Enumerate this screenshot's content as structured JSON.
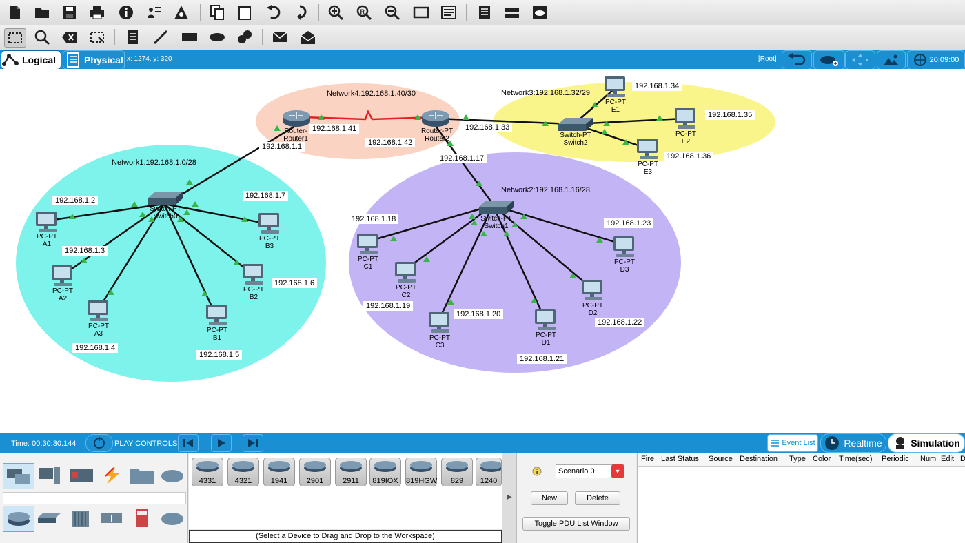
{
  "toolbar1": {
    "icons": [
      "new-file-icon",
      "open-folder-icon",
      "save-icon",
      "print-icon",
      "info-icon",
      "activity-wizard-icon",
      "network-info-icon",
      "copy-icon",
      "paste-icon",
      "undo-icon",
      "redo-icon",
      "zoom-in-icon",
      "zoom-reset-icon",
      "zoom-out-icon",
      "drawing-palette-icon",
      "custom-device-icon",
      "notes-icon",
      "device-dialog-icon",
      "cloud-viewer-icon"
    ]
  },
  "toolbar2": {
    "icons": [
      "select-icon",
      "inspect-icon",
      "delete-icon",
      "resize-icon",
      "note-icon",
      "line-icon",
      "rectangle-icon",
      "ellipse-icon",
      "freeform-icon",
      "add-simple-pdu-icon",
      "add-complex-pdu-icon"
    ]
  },
  "tabs": {
    "logical": "Logical",
    "physical": "Physical",
    "coords": "x: 1274, y: 320",
    "root": "[Root]",
    "clock": "20:09:00"
  },
  "networks": {
    "n1": "Network1:192.168.1.0/28",
    "n2": "Network2:192.168.1.16/28",
    "n3": "Network3:192.168.1.32/29",
    "n4": "Network4:192.168.1.40/30"
  },
  "ips": {
    "r1_s": "192.168.1.41",
    "r1_f": "192.168.1.1",
    "r2_s": "192.168.1.42",
    "r2_f0": "192.168.1.33",
    "r2_f1": "192.168.1.17",
    "a1": "192.168.1.2",
    "a2": "192.168.1.3",
    "a3": "192.168.1.4",
    "b1": "192.168.1.5",
    "b2": "192.168.1.6",
    "b3": "192.168.1.7",
    "c1": "192.168.1.18",
    "c2": "192.168.1.19",
    "c3": "192.168.1.20",
    "d1": "192.168.1.21",
    "d2": "192.168.1.22",
    "d3": "192.168.1.23",
    "e1": "192.168.1.34",
    "e2": "192.168.1.35",
    "e3": "192.168.1.36"
  },
  "devices": {
    "router1": {
      "type": "Router-",
      "name": "Router1"
    },
    "router2": {
      "type": "Router-PT",
      "name": "Router2"
    },
    "switch0": {
      "type": "Switch-PT",
      "name": "Switch0"
    },
    "switch1": {
      "type": "Switch-PT",
      "name": "Switch1"
    },
    "switch2": {
      "type": "Switch-PT",
      "name": "Switch2"
    },
    "pcType": "PC-PT",
    "a1": "A1",
    "a2": "A2",
    "a3": "A3",
    "b1": "B1",
    "b2": "B2",
    "b3": "B3",
    "c1": "C1",
    "c2": "C2",
    "c3": "C3",
    "d1": "D1",
    "d2": "D2",
    "d3": "D3",
    "e1": "E1",
    "e2": "E2",
    "e3": "E3"
  },
  "simbar": {
    "time": "Time: 00:30:30.144",
    "play": "PLAY CONTROLS:",
    "eventlist": "Event List",
    "realtime": "Realtime",
    "simulation": "Simulation"
  },
  "devicepanel": {
    "models": [
      "4331",
      "4321",
      "1941",
      "2901",
      "2911",
      "819IOX",
      "819HGW",
      "829",
      "1240"
    ],
    "hint": "(Select a Device to Drag and Drop to the Workspace)"
  },
  "pdu": {
    "scenario": "Scenario 0",
    "new": "New",
    "delete": "Delete",
    "toggle": "Toggle PDU List Window",
    "columns": [
      "Fire",
      "Last Status",
      "Source",
      "Destination",
      "Type",
      "Color",
      "Time(sec)",
      "Periodic",
      "Num",
      "Edit",
      "D"
    ]
  },
  "colors": {
    "net1": "#7ef3ec",
    "net2": "#c3b4f6",
    "net3": "#faf58b",
    "net4": "#fad3c2",
    "serial": "#e62020",
    "blue": "#1a8fd2"
  }
}
